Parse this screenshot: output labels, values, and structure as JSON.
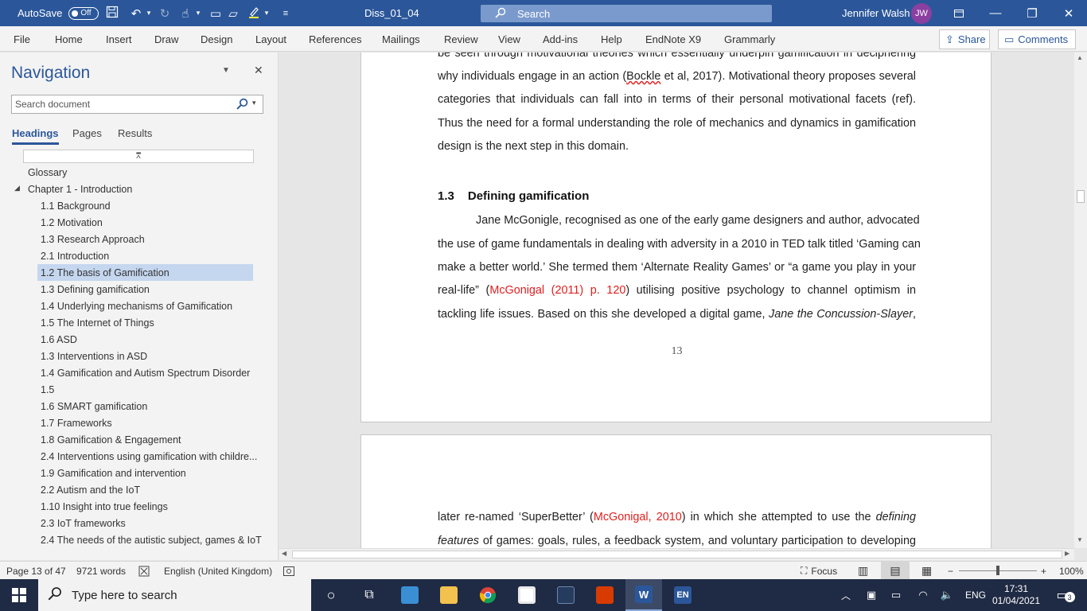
{
  "titlebar": {
    "autosave_label": "AutoSave",
    "autosave_state": "Off",
    "doc_title": "Diss_01_04",
    "search_label": "Search",
    "user_name": "Jennifer Walsh",
    "user_initials": "JW"
  },
  "ribbon": {
    "tabs": [
      "File",
      "Home",
      "Insert",
      "Draw",
      "Design",
      "Layout",
      "References",
      "Mailings",
      "Review",
      "View",
      "Add-ins",
      "Help",
      "EndNote X9",
      "Grammarly"
    ],
    "share_label": "Share",
    "comments_label": "Comments"
  },
  "navigation": {
    "title": "Navigation",
    "search_placeholder": "Search document",
    "tabs": [
      "Headings",
      "Pages",
      "Results"
    ],
    "headings": [
      "Glossary",
      "Chapter 1 - Introduction",
      "1.1 Background",
      "1.2 Motivation",
      "1.3 Research Approach",
      "2.1  Introduction",
      "1.2 The basis of Gamification",
      "1.3 Defining gamification",
      "1.4 Underlying mechanisms of Gamification",
      "1.5 The Internet of Things",
      "1.6 ASD",
      "1.3  Interventions in ASD",
      "1.4 Gamification and Autism Spectrum Disorder",
      "1.5",
      "1.6 SMART gamification",
      "1.7 Frameworks",
      "1.8 Gamification & Engagement",
      "2.4 Interventions using gamification with childre...",
      "1.9 Gamification and intervention",
      "2.2 Autism and the IoT",
      "1.10 Insight into true feelings",
      "2.3 IoT frameworks",
      "2.4 The needs of the autistic subject, games & IoT"
    ],
    "selected_heading": "1.2 The basis of Gamification"
  },
  "document": {
    "page13": {
      "para1": [
        "be seen through motivational theories which essentially underpin gamification in deciphering",
        "why individuals engage in an action (",
        "Bockle",
        " et al, 2017). Motivational theory proposes several",
        "categories that individuals can fall into in terms of their personal motivational facets (ref).",
        "Thus the need for a formal understanding the role of mechanics and dynamics in gamification",
        "design is the next step in this domain."
      ],
      "section_number": "1.3",
      "section_title": "Defining gamification",
      "para2": [
        "Jane McGonigle, recognised as one of the early game designers and author, advocated",
        "the use of game fundamentals in dealing with adversity in a 2010 in TED talk titled ‘Gaming can",
        "make a better world.’ She termed them ‘Alternate Reality Games’ or  “a game you play in your",
        "real-life” (",
        "McGonigal (2011) p. 120",
        ") utilising positive psychology to channel optimism in",
        "tackling life issues. Based on this she developed a digital game, ",
        "Jane the Concussion-Slayer",
        ","
      ],
      "page_number": "13"
    },
    "page14": {
      "line1_a": "later re-named ‘SuperBetter’ (",
      "line1_ref": "McGonigal, 2010",
      "line1_b": ") in which she attempted to use the ",
      "line1_italic": "defining",
      "line2_italic": "features",
      "line2_b": " of games: goals, rules, a feedback system, and voluntary participation to developing"
    }
  },
  "status": {
    "page": "Page 13 of 47",
    "words": "9721 words",
    "language": "English (United Kingdom)",
    "focus": "Focus",
    "zoom": "100%"
  },
  "taskbar": {
    "search_placeholder": "Type here to search",
    "lang": "ENG",
    "time": "17:31",
    "date": "01/04/2021",
    "notifications": "3",
    "en_label": "EN"
  }
}
